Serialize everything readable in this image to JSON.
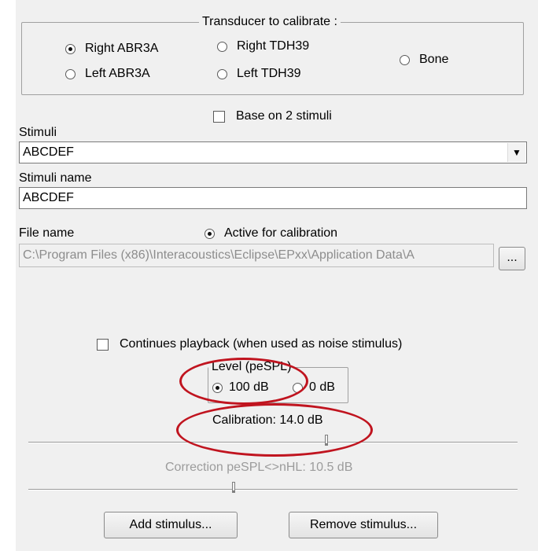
{
  "transducer": {
    "title": "Transducer to calibrate :",
    "options": [
      {
        "label": "Right ABR3A",
        "selected": true
      },
      {
        "label": "Right TDH39",
        "selected": false
      },
      {
        "label": "Bone",
        "selected": false
      },
      {
        "label": "Left ABR3A",
        "selected": false
      },
      {
        "label": "Left TDH39",
        "selected": false
      }
    ]
  },
  "base_on_2_stimuli": {
    "label": "Base on 2 stimuli",
    "checked": false
  },
  "stimuli": {
    "label": "Stimuli",
    "value": "ABCDEF",
    "arrow": "▼"
  },
  "stimuli_name": {
    "label": "Stimuli name",
    "value": "ABCDEF"
  },
  "file_name": {
    "label": "File name",
    "active_label": "Active for calibration",
    "active_selected": true,
    "value": "C:\\Program Files (x86)\\Interacoustics\\Eclipse\\EPxx\\Application Data\\A",
    "browse_label": "..."
  },
  "continues_playback": {
    "label": "Continues playback (when used as noise stimulus)",
    "checked": false
  },
  "level": {
    "title": "Level (peSPL)",
    "options": [
      {
        "label": "100 dB",
        "selected": true
      },
      {
        "label": "0 dB",
        "selected": false
      }
    ]
  },
  "calibration": {
    "label": "Calibration: 14.0 dB",
    "slider_fraction": 0.61
  },
  "correction": {
    "label": "Correction peSPL<>nHL: 10.5 dB",
    "slider_fraction": 0.42
  },
  "buttons": {
    "add": "Add stimulus...",
    "remove": "Remove stimulus..."
  },
  "colors": {
    "annotation": "#c0141f",
    "window_bg": "#f0f0f0"
  }
}
